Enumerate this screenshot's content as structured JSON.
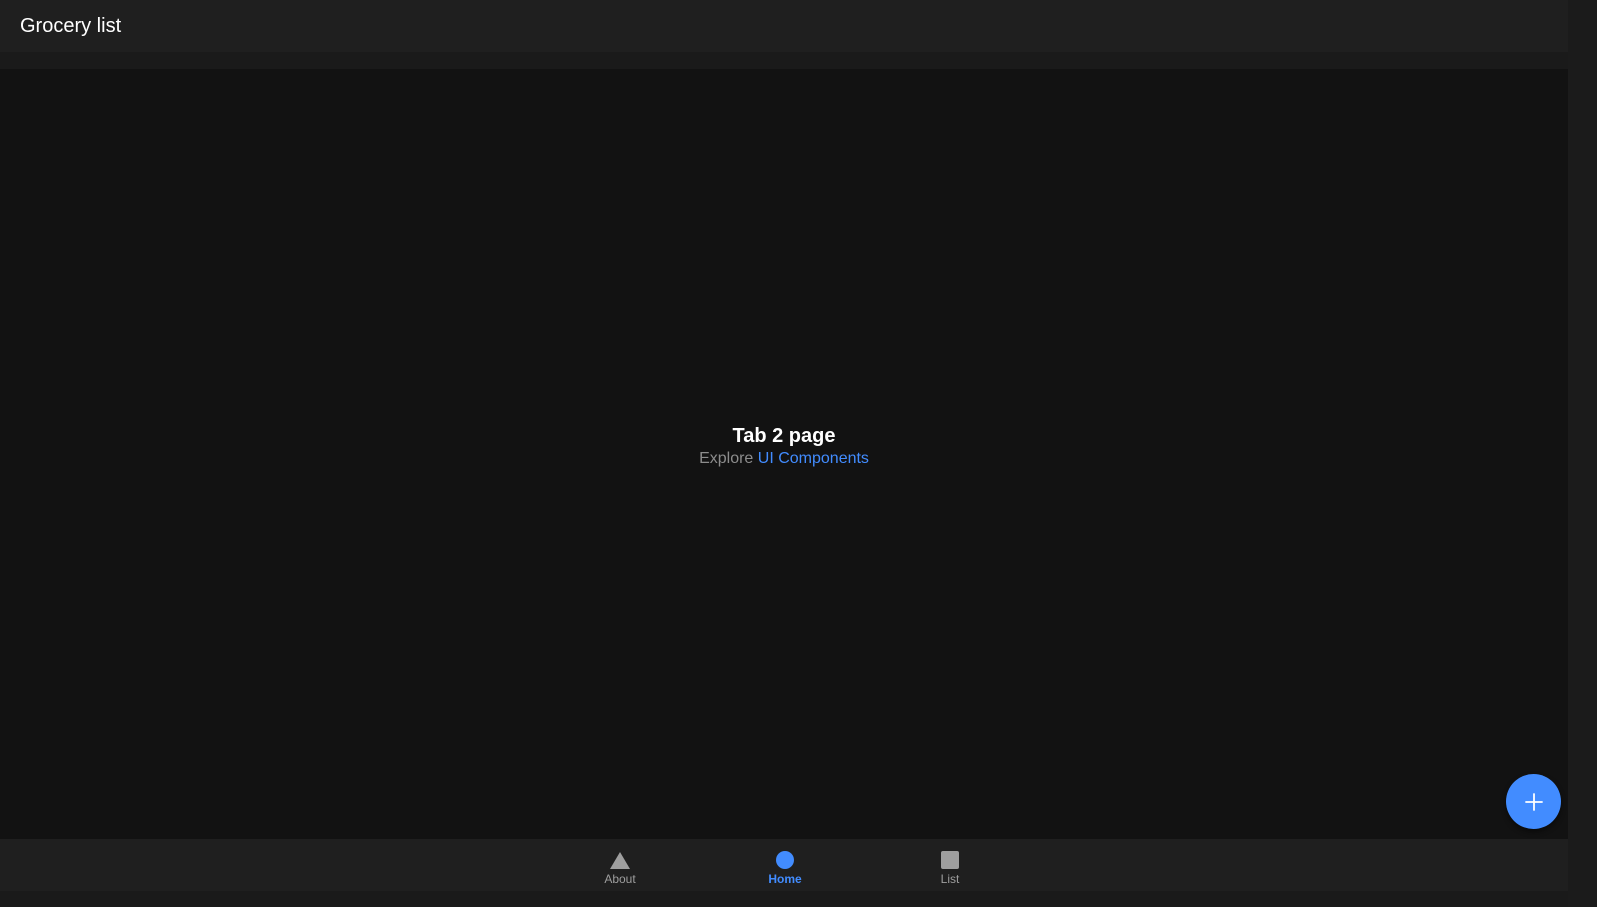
{
  "header": {
    "title": "Grocery list"
  },
  "main": {
    "heading": "Tab 2 page",
    "explore_prefix": "Explore",
    "explore_link": "UI Components"
  },
  "fab": {
    "icon": "add-icon"
  },
  "tabs": [
    {
      "label": "About",
      "icon": "triangle-icon",
      "selected": false
    },
    {
      "label": "Home",
      "icon": "ellipse-icon",
      "selected": true
    },
    {
      "label": "List",
      "icon": "square-icon",
      "selected": false
    }
  ],
  "colors": {
    "accent": "#428cff",
    "background": "#121212",
    "toolbar": "#1f1f1f",
    "inactive_tab": "#9e9e9e"
  }
}
